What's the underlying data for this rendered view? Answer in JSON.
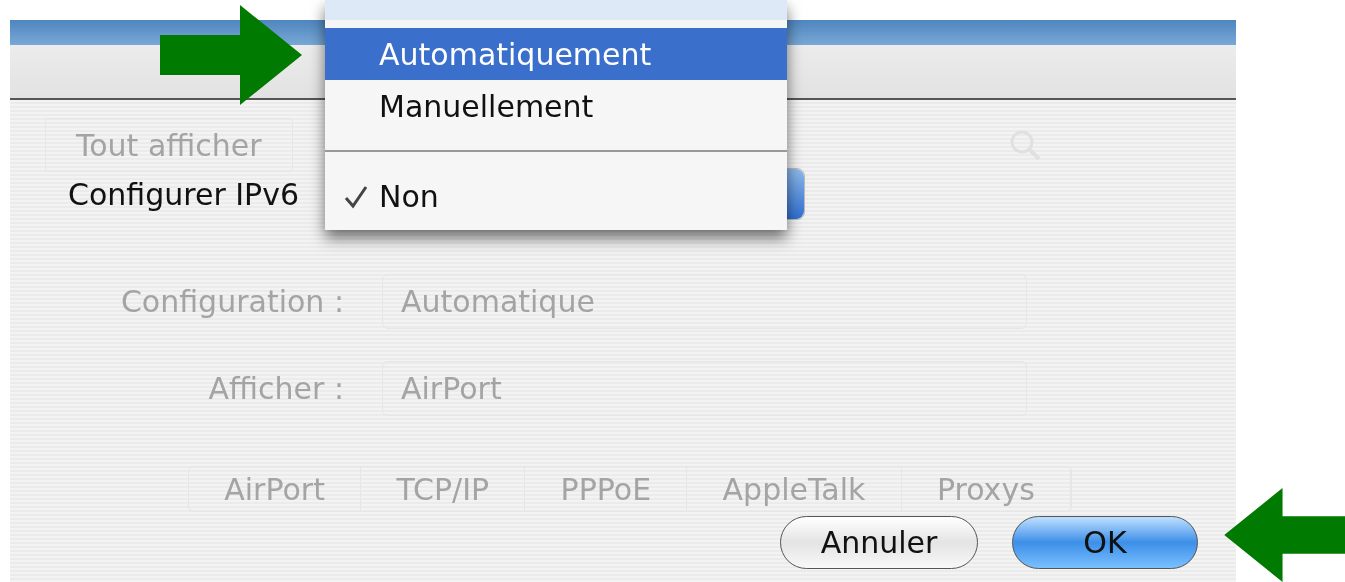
{
  "background_window": {
    "toolbar": {
      "show_all_button": "Tout afficher"
    },
    "fields": [
      {
        "label": "Configuration :",
        "value": "Automatique"
      },
      {
        "label": "Afficher :",
        "value": "AirPort"
      }
    ],
    "tabs": [
      {
        "label": "AirPort"
      },
      {
        "label": "TCP/IP"
      },
      {
        "label": "PPPoE"
      },
      {
        "label": "AppleTalk"
      },
      {
        "label": "Proxys"
      }
    ]
  },
  "sheet": {
    "label": "Configurer IPv6",
    "menu": {
      "items": [
        {
          "kind": "item",
          "label": "Automatiquement",
          "highlighted": true,
          "checked": false
        },
        {
          "kind": "item",
          "label": "Manuellement",
          "highlighted": false,
          "checked": false
        },
        {
          "kind": "separator"
        },
        {
          "kind": "item",
          "label": "Non",
          "highlighted": false,
          "checked": true
        }
      ]
    },
    "buttons": [
      {
        "label": "Annuler",
        "default": false
      },
      {
        "label": "OK",
        "default": true
      }
    ]
  },
  "annotations": [
    {
      "kind": "rightarrow"
    },
    {
      "kind": "leftarrow"
    }
  ]
}
